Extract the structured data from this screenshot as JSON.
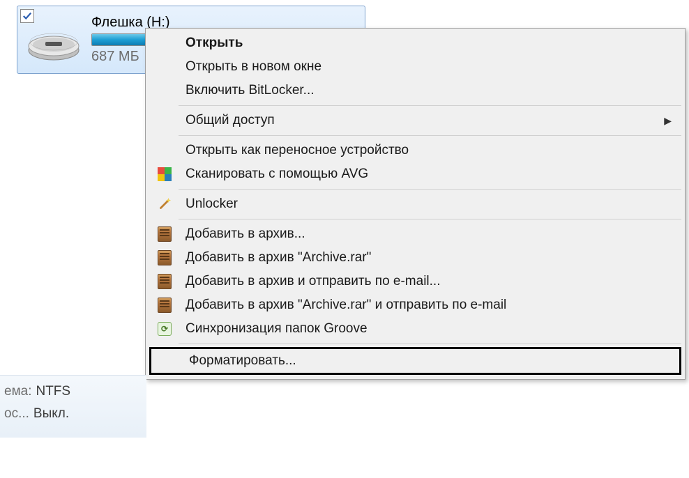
{
  "drive": {
    "name": "Флешка (H:)",
    "size_text": "687 МБ"
  },
  "menu": {
    "open": "Открыть",
    "open_new_window": "Открыть в новом окне",
    "bitlocker": "Включить BitLocker...",
    "sharing": "Общий доступ",
    "open_portable": "Открыть как переносное устройство",
    "scan_avg": "Сканировать с помощью AVG",
    "unlocker": "Unlocker",
    "add_archive": "Добавить в архив...",
    "add_archive_rar": "Добавить в архив \"Archive.rar\"",
    "add_archive_email": "Добавить в архив и отправить по e-mail...",
    "add_archive_rar_email": "Добавить в архив \"Archive.rar\" и отправить по e-mail",
    "groove_sync": "Синхронизация папок Groove",
    "format": "Форматировать..."
  },
  "bottom": {
    "fs_prefix": "ема:",
    "fs_value": "NTFS",
    "state_prefix": "ос...",
    "state_value": "Выкл."
  }
}
